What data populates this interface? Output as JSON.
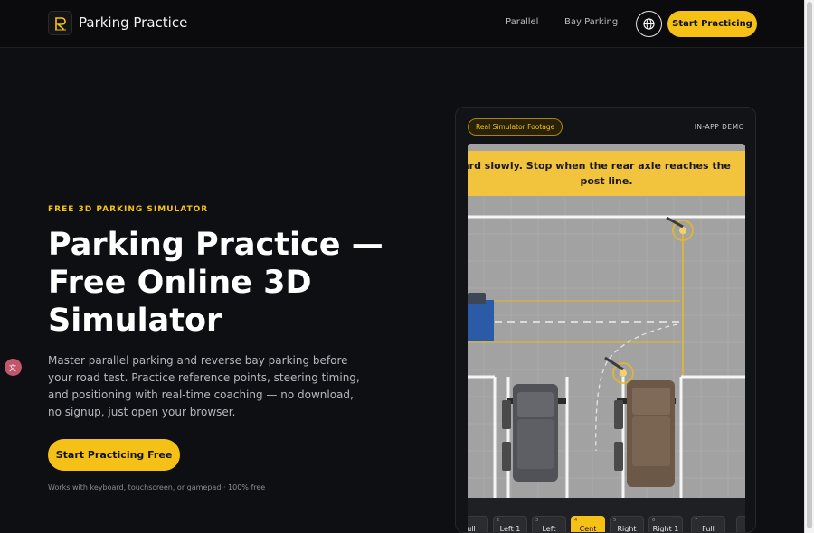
{
  "header": {
    "brand": "Parking Practice",
    "nav": [
      "Parallel",
      "Bay Parking"
    ],
    "cta": "Start Practicing"
  },
  "hero": {
    "eyebrow": "FREE 3D PARKING SIMULATOR",
    "title": "Parking Practice — Free Online 3D Simulator",
    "description": "Master parallel parking and reverse bay parking before your road test. Practice reference points, steering timing, and positioning with real-time coaching — no download, no signup, just open your browser.",
    "cta": "Start Practicing Free",
    "footnote": "Works with keyboard, touchscreen, or gamepad · 100% free"
  },
  "demo": {
    "badge": "Real Simulator Footage",
    "label": "IN-APP DEMO",
    "instruction_line1": "orward slowly. Stop when the rear axle reaches the",
    "instruction_line2": "post line.",
    "toolbar": [
      {
        "num": "",
        "label": "ull"
      },
      {
        "num": "2",
        "label": "Left 1"
      },
      {
        "num": "3",
        "label": "Left"
      },
      {
        "num": "4",
        "label": "Cent"
      },
      {
        "num": "5",
        "label": "Right"
      },
      {
        "num": "6",
        "label": "Right 1"
      },
      {
        "num": "7",
        "label": "Full"
      }
    ],
    "active_index": 3
  },
  "colors": {
    "accent": "#f5c116",
    "background": "#0e0f12",
    "guide_line": "#e8b923"
  }
}
